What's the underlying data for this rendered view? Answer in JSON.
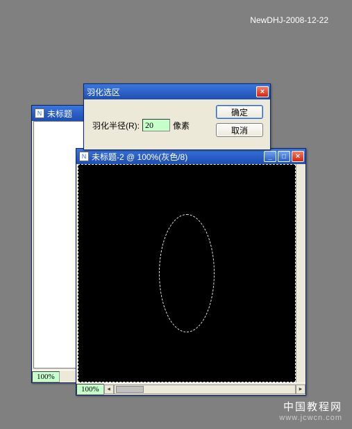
{
  "watermark": {
    "top": "NewDHJ-2008-12-22",
    "bottom1": "中国教程网",
    "bottom2": "www.jcwcn.com"
  },
  "dialog": {
    "title": "羽化选区",
    "field_label": "羽化半径(R):",
    "value": "20",
    "unit": "像素",
    "ok": "确定",
    "cancel": "取消"
  },
  "win_back": {
    "title": "未标题",
    "zoom": "100%"
  },
  "win_front": {
    "title": "未标题-2 @ 100%(灰色/8)",
    "zoom": "100%"
  }
}
